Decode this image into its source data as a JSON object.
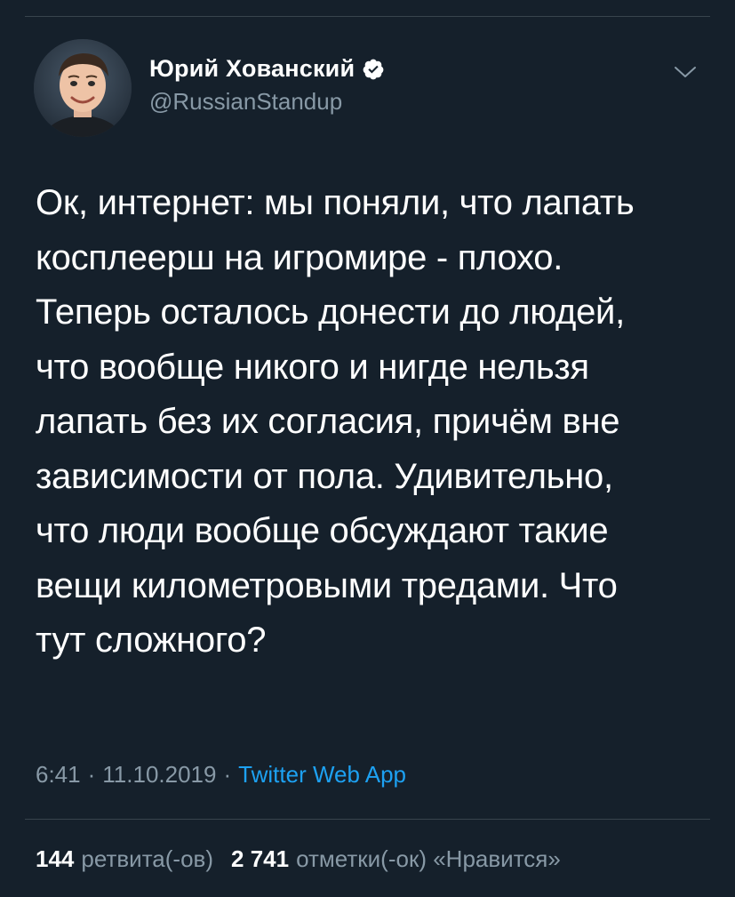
{
  "tweet": {
    "author": {
      "display_name": "Юрий Хованский",
      "handle": "@RussianStandup",
      "verified": true
    },
    "text": "Ок, интернет: мы поняли, что лапать\nкосплеерш на игромире - плохо.\nТеперь осталось донести до людей,\nчто вообще никого и нигде нельзя\nлапать без их согласия, причём вне\nзависимости от пола. Удивительно,\nчто люди вообще обсуждают такие\nвещи километровыми тредами. Что\nтут сложного?",
    "time": "6:41",
    "date": "11.10.2019",
    "source": "Twitter Web App",
    "separator": "·",
    "retweets": {
      "count": "144",
      "label": "ретвита(-ов)"
    },
    "likes": {
      "count": "2 741",
      "label": "отметки(-ок) «Нравится»"
    }
  },
  "colors": {
    "background": "#15202b",
    "text_primary": "#ffffff",
    "text_secondary": "#8899a6",
    "accent": "#1da1f2",
    "divider": "#38444d"
  },
  "icons": {
    "verified": "verified-badge-icon",
    "caret": "chevron-down-icon"
  }
}
